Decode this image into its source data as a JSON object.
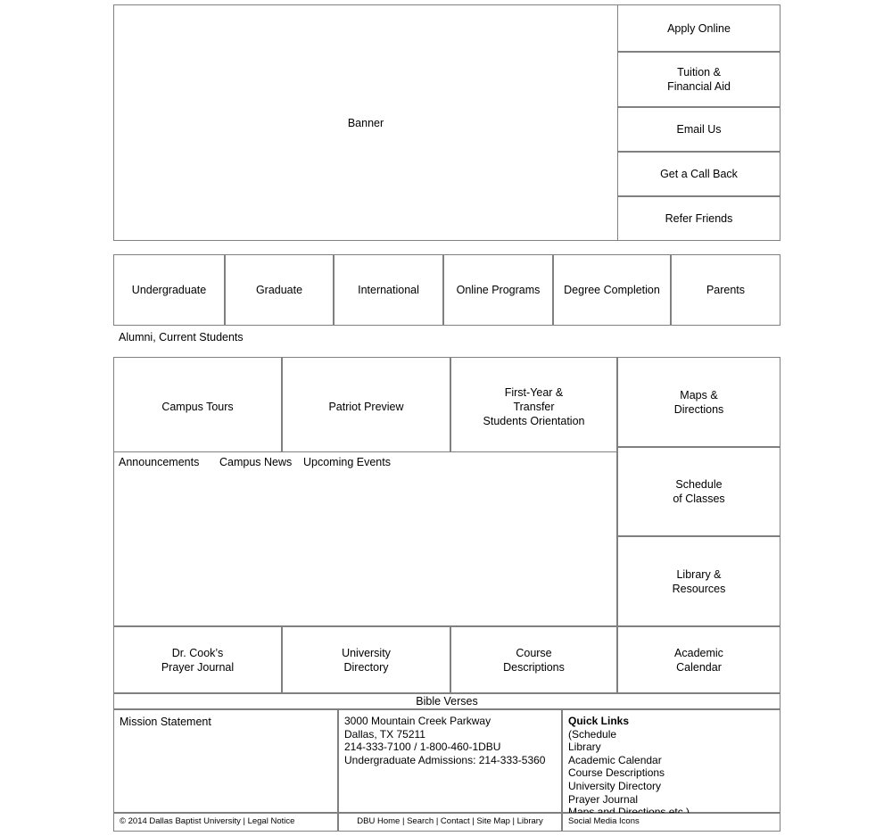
{
  "banner": {
    "label": "Banner"
  },
  "action_buttons": [
    {
      "label": "Apply Online"
    },
    {
      "label": "Tuition &\nFinancial Aid"
    },
    {
      "label": "Email Us"
    },
    {
      "label": "Get a Call Back"
    },
    {
      "label": "Refer Friends"
    }
  ],
  "audience_nav": {
    "items": [
      {
        "label": "Undergraduate"
      },
      {
        "label": "Graduate"
      },
      {
        "label": "International"
      },
      {
        "label": "Online Programs"
      },
      {
        "label": "Degree Completion"
      },
      {
        "label": "Parents"
      }
    ],
    "secondary_label": "Alumni, Current Students"
  },
  "visit_row": [
    {
      "label": "Campus Tours"
    },
    {
      "label": "Patriot Preview"
    },
    {
      "label": "First-Year &\nTransfer\nStudents Orientation"
    }
  ],
  "right_column": [
    {
      "label": "Maps &\nDirections"
    },
    {
      "label": "Schedule\nof Classes"
    },
    {
      "label": "Library &\nResources"
    }
  ],
  "news_tabs": {
    "items": [
      {
        "label": "Announcements"
      },
      {
        "label": "Campus News"
      },
      {
        "label": "Upcoming Events"
      }
    ]
  },
  "resource_row": [
    {
      "label": "Dr. Cook’s\nPrayer Journal"
    },
    {
      "label": "University\nDirectory"
    },
    {
      "label": "Course\nDescriptions"
    },
    {
      "label": "Academic\nCalendar"
    }
  ],
  "bible_verses": {
    "label": "Bible Verses"
  },
  "footer": {
    "mission_statement": "Mission Statement",
    "address": "3000 Mountain Creek Parkway\nDallas, TX 75211\n214-333-7100 / 1-800-460-1DBU\nUndergraduate Admissions: 214-333-5360",
    "quick_links_title": "Quick Links",
    "quick_links": "(Schedule\nLibrary\nAcademic Calendar\nCourse Descriptions\nUniversity Directory\nPrayer Journal\nMaps and Directions etc.)",
    "copyright": "© 2014 Dallas Baptist University | Legal Notice",
    "utility_links": "DBU Home | Search | Contact | Site Map | Library",
    "social_media": "Social Media Icons"
  }
}
